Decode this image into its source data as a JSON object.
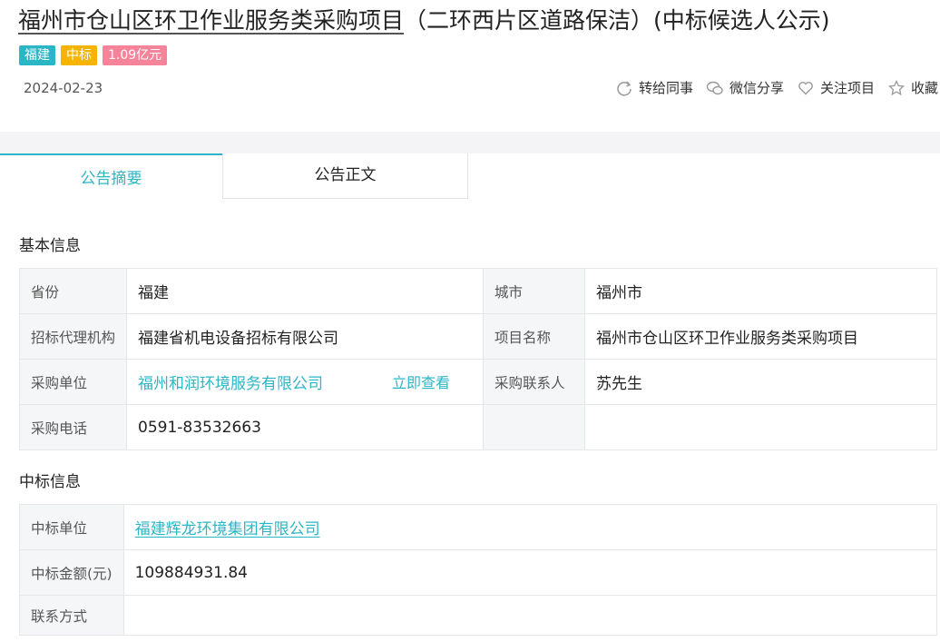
{
  "title_main": "福州市仓山区环卫作业服务类采购项目",
  "title_suffix": "（二环西片区道路保洁）(中标候选人公示)",
  "tags": {
    "region": "福建",
    "status": "中标",
    "amount": "1.09亿元"
  },
  "date": "2024-02-23",
  "actions": {
    "forward": "转给同事",
    "wechat": "微信分享",
    "follow": "关注项目",
    "favorite": "收藏"
  },
  "tabs": {
    "summary": "公告摘要",
    "body": "公告正文"
  },
  "basic": {
    "title": "基本信息",
    "province_label": "省份",
    "province": "福建",
    "city_label": "城市",
    "city": "福州市",
    "agency_label": "招标代理机构",
    "agency": "福建省机电设备招标有限公司",
    "project_label": "项目名称",
    "project": "福州市仓山区环卫作业服务类采购项目",
    "buyer_label": "采购单位",
    "buyer": "福州和润环境服务有限公司",
    "buyer_view": "立即查看",
    "contact_label": "采购联系人",
    "contact": "苏先生",
    "phone_label": "采购电话",
    "phone": "0591-83532663"
  },
  "winner": {
    "title": "中标信息",
    "unit_label": "中标单位",
    "unit": "福建辉龙环境集团有限公司",
    "amount_label": "中标金额(元)",
    "amount": "109884931.84",
    "contact_label": "联系方式",
    "contact": ""
  },
  "colors": {
    "accent": "#2bb6c6",
    "tag_status": "#f5b400",
    "tag_amount": "#f5849a"
  }
}
